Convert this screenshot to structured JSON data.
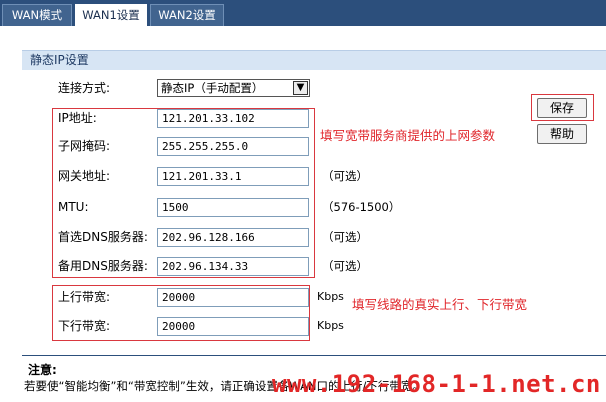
{
  "tabs": [
    {
      "label": "WAN模式",
      "active": false
    },
    {
      "label": "WAN1设置",
      "active": true
    },
    {
      "label": "WAN2设置",
      "active": false
    }
  ],
  "section": {
    "title": "静态IP设置"
  },
  "connection": {
    "label": "连接方式:",
    "selected": "静态IP（手动配置）"
  },
  "fields": {
    "ip": {
      "label": "IP地址:",
      "value": "121.201.33.102"
    },
    "subnet": {
      "label": "子网掩码:",
      "value": "255.255.255.0"
    },
    "gateway": {
      "label": "网关地址:",
      "value": "121.201.33.1",
      "hint": "（可选）"
    },
    "mtu": {
      "label": "MTU:",
      "value": "1500",
      "hint": "（576-1500）"
    },
    "dns1": {
      "label": "首选DNS服务器:",
      "value": "202.96.128.166",
      "hint": "（可选）"
    },
    "dns2": {
      "label": "备用DNS服务器:",
      "value": "202.96.134.33",
      "hint": "（可选）"
    },
    "upload": {
      "label": "上行带宽:",
      "value": "20000",
      "unit": "Kbps"
    },
    "download": {
      "label": "下行带宽:",
      "value": "20000",
      "unit": "Kbps"
    }
  },
  "annotations": {
    "isp_params": "填写宽带服务商提供的上网参数",
    "bandwidth": "填写线路的真实上行、下行带宽"
  },
  "buttons": {
    "save": "保存",
    "help": "帮助"
  },
  "note": {
    "title": "注意:",
    "text": "若要使“智能均衡”和“带宽控制”生效，请正确设置各WAN口的上行/下行带宽。"
  },
  "watermark": "www.192-168-1-1.net.cn",
  "colors": {
    "tab_bar": "#2c4f7c",
    "section_header": "#d7e5f4",
    "annotation_red": "#e0262b"
  }
}
